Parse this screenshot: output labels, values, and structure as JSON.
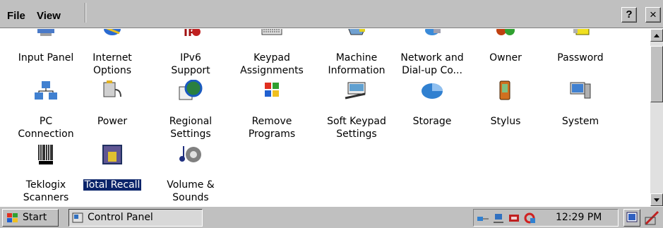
{
  "menu": {
    "file": "File",
    "view": "View",
    "help_label": "?",
    "close_label": "×"
  },
  "items": [
    {
      "label": "Input Panel",
      "icon": "input-panel-icon"
    },
    {
      "label": "Internet\nOptions",
      "icon": "internet-options-icon"
    },
    {
      "label": "IPv6\nSupport",
      "icon": "ipv6-icon"
    },
    {
      "label": "Keypad\nAssignments",
      "icon": "keypad-icon"
    },
    {
      "label": "Machine\nInformation",
      "icon": "machine-info-icon"
    },
    {
      "label": "Network and\nDial-up Co...",
      "icon": "network-icon"
    },
    {
      "label": "Owner",
      "icon": "owner-icon"
    },
    {
      "label": "Password",
      "icon": "password-icon"
    },
    {
      "label": "PC\nConnection",
      "icon": "pc-connection-icon"
    },
    {
      "label": "Power",
      "icon": "power-icon"
    },
    {
      "label": "Regional\nSettings",
      "icon": "regional-settings-icon"
    },
    {
      "label": "Remove\nPrograms",
      "icon": "remove-programs-icon"
    },
    {
      "label": "Soft Keypad\nSettings",
      "icon": "soft-keypad-icon"
    },
    {
      "label": "Storage",
      "icon": "storage-icon"
    },
    {
      "label": "Stylus",
      "icon": "stylus-icon"
    },
    {
      "label": "System",
      "icon": "system-icon"
    },
    {
      "label": "Teklogix\nScanners",
      "icon": "barcode-icon"
    },
    {
      "label": "Total Recall",
      "icon": "total-recall-icon",
      "selected": true
    },
    {
      "label": "Volume &\nSounds",
      "icon": "volume-icon"
    }
  ],
  "taskbar": {
    "start": "Start",
    "task": "Control Panel",
    "clock": "12:29 PM"
  },
  "colors": {
    "chrome": "#c0c0c0",
    "selection": "#0a246a"
  }
}
